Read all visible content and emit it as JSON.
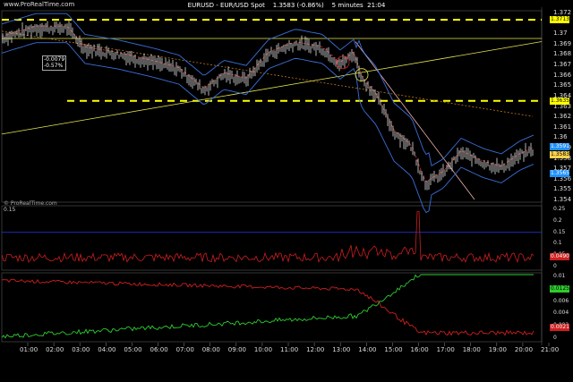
{
  "header": {
    "brand": "www.ProRealTime.com",
    "instrument": "EURUSD - EUR/USD Spot",
    "last": "1.3583 (-0.86%)",
    "timeframe": "5 minutes",
    "time": "21:04"
  },
  "watermark": "© ProRealTime.com",
  "variation_box": {
    "abs": "-0.0079",
    "pct": "-0.57%"
  },
  "price_axis": {
    "ticks": [
      "1.372",
      "1.37",
      "1.369",
      "1.368",
      "1.367",
      "1.366",
      "1.365",
      "1.364",
      "1.363",
      "1.362",
      "1.361",
      "1.36",
      "1.359",
      "1.358",
      "1.357",
      "1.356",
      "1.355",
      "1.354"
    ],
    "boxes": [
      {
        "label": "1.3713",
        "color": "#ffff00",
        "text_color": "#000"
      },
      {
        "label": "1.3635",
        "color": "#ffff00",
        "text_color": "#000"
      },
      {
        "label": "1.3591",
        "color": "#1e90ff",
        "text_color": "#fff"
      },
      {
        "label": "1.3583",
        "color": "#ffd24d",
        "text_color": "#000"
      },
      {
        "label": "1.3565",
        "color": "#1e90ff",
        "text_color": "#fff"
      }
    ]
  },
  "indicator1_axis": {
    "ticks": [
      "0.25",
      "0.2",
      "0.15",
      "0.1",
      "0.05",
      "0"
    ],
    "level_label": "0.15",
    "value_box": "0.0490"
  },
  "indicator2_axis": {
    "ticks": [
      "0.01",
      "0.008",
      "0.006",
      "0.004",
      "0.002",
      "0"
    ],
    "value_box_green": "0.0125",
    "value_box_red": "0.0021"
  },
  "time_axis": [
    "01:00",
    "02:00",
    "03:00",
    "04:00",
    "05:00",
    "06:00",
    "07:00",
    "08:00",
    "09:00",
    "10:00",
    "11:00",
    "12:00",
    "13:00",
    "14:00",
    "15:00",
    "16:00",
    "17:00",
    "18:00",
    "19:00",
    "20:00",
    "21:00"
  ],
  "colors": {
    "background": "#000000",
    "price_bars": "#ffffff",
    "bollinger": "#3a6fd8",
    "ma_red": "#cc2a2a",
    "ma_orange": "#c07820",
    "trendline": "#e6e64d",
    "level_dash": "#ffff00",
    "ind_red": "#cc1f1f",
    "ind_green": "#2ecc2e",
    "ind_blue_line": "#2233dd"
  }
}
